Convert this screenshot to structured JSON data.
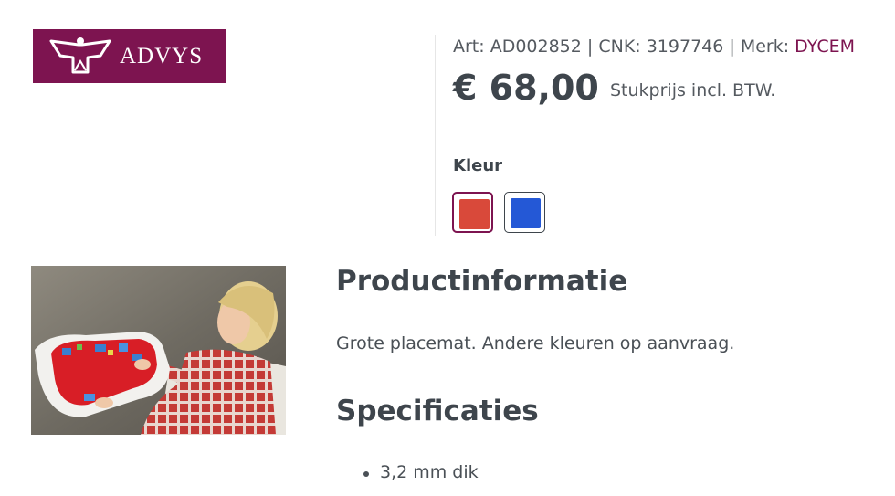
{
  "logo": {
    "text": "ADVYS"
  },
  "product": {
    "meta_prefix": "Art: AD002852 | CNK: 3197746 | Merk:",
    "brand": "DYCEM",
    "price": "€ 68,00",
    "price_note": "Stukprijs incl. BTW.",
    "color_label": "Kleur",
    "colors": [
      {
        "name": "red",
        "hex": "#d9493a",
        "selected": true
      },
      {
        "name": "blue",
        "hex": "#2458d6",
        "selected": false
      }
    ]
  },
  "info": {
    "heading": "Productinformatie",
    "description": "Grote placemat. Andere kleuren op aanvraag.",
    "spec_heading": "Specificaties",
    "specs": [
      "3,2 mm dik"
    ]
  },
  "colors": {
    "brand": "#7d1450",
    "heading": "#3e454c"
  }
}
